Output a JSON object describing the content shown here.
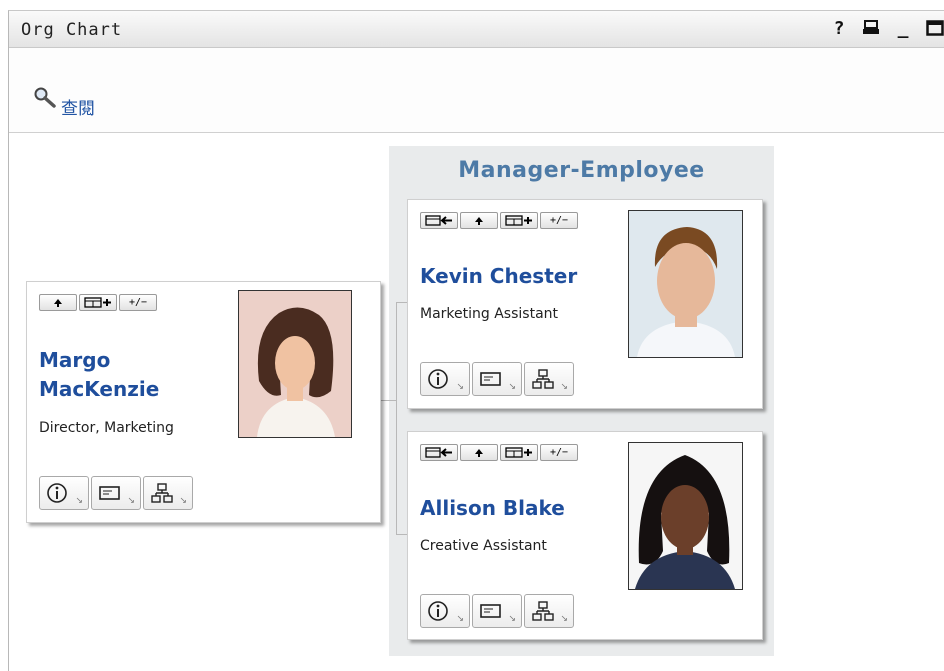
{
  "window": {
    "title": "Org Chart",
    "help_glyph": "?",
    "minimize_glyph": "_"
  },
  "toolbar": {
    "view_label": "查閱"
  },
  "panel": {
    "title": "Manager-Employee"
  },
  "buttons": {
    "plus_minus": "+/−"
  },
  "people": {
    "margo": {
      "name_line1": "Margo",
      "name_line2": "MacKenzie",
      "title": "Director, Marketing"
    },
    "kevin": {
      "name": "Kevin Chester",
      "title": "Marketing Assistant"
    },
    "allison": {
      "name": "Allison Blake",
      "title": "Creative Assistant"
    }
  },
  "icons": [
    "help-icon",
    "print-icon",
    "minimize-icon",
    "maximize-icon",
    "search-icon",
    "up-arrow-icon",
    "expand-tree-icon",
    "toggle-icon",
    "back-manager-icon",
    "info-icon",
    "email-card-icon",
    "org-tree-icon"
  ]
}
